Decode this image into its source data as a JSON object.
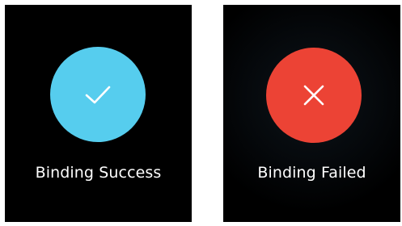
{
  "panels": [
    {
      "status": "success",
      "icon": "check-icon",
      "circle_color": "#56cdee",
      "label": "Binding Success"
    },
    {
      "status": "failed",
      "icon": "close-icon",
      "circle_color": "#ec4335",
      "label": "Binding Failed"
    }
  ]
}
